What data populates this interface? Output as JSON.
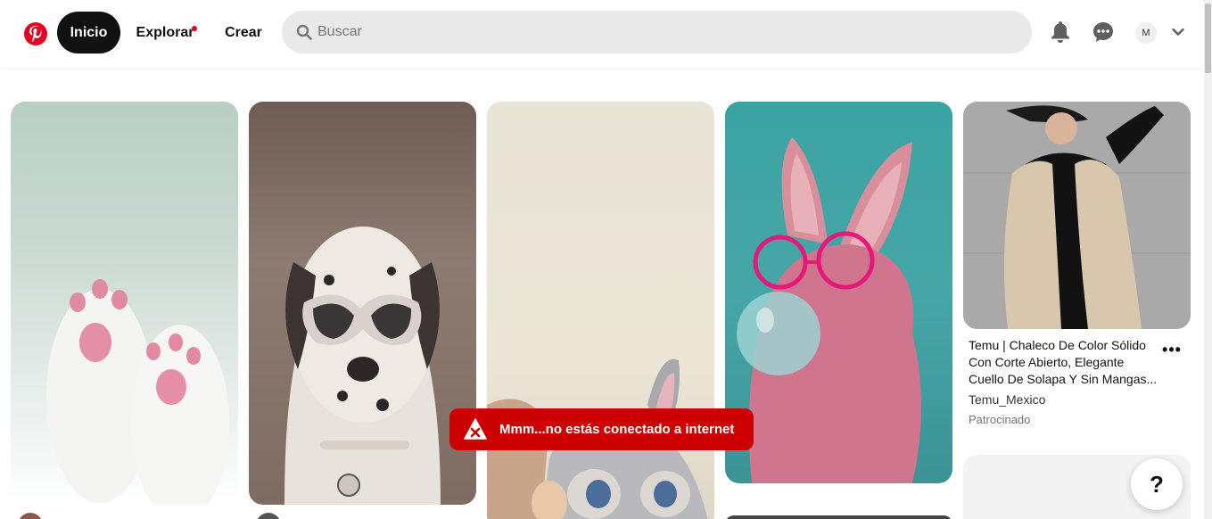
{
  "header": {
    "nav": [
      {
        "label": "Inicio"
      },
      {
        "label": "Explorar"
      },
      {
        "label": "Crear"
      }
    ],
    "search_placeholder": "Buscar",
    "avatar_initial": "M",
    "icons": [
      "pinterest-logo-icon",
      "search-icon",
      "bell-icon",
      "messages-icon",
      "chevron-down-icon"
    ]
  },
  "pins": {
    "featured": {
      "title": "Temu | Chaleco De Color Sólido Con Corte Abierto, Elegante Cuello De Solapa Y Sin Mangas...",
      "source": "Temu_Mexico",
      "sponsored": "Patrocinado",
      "more": "•••"
    }
  },
  "toast": {
    "message": "Mmm...no estás conectado a internet"
  },
  "help_button": "?",
  "colors": {
    "brand": "#e60023",
    "toast": "#cc0000",
    "nav_active": "#111111",
    "search_bg": "#e9e9e9"
  }
}
